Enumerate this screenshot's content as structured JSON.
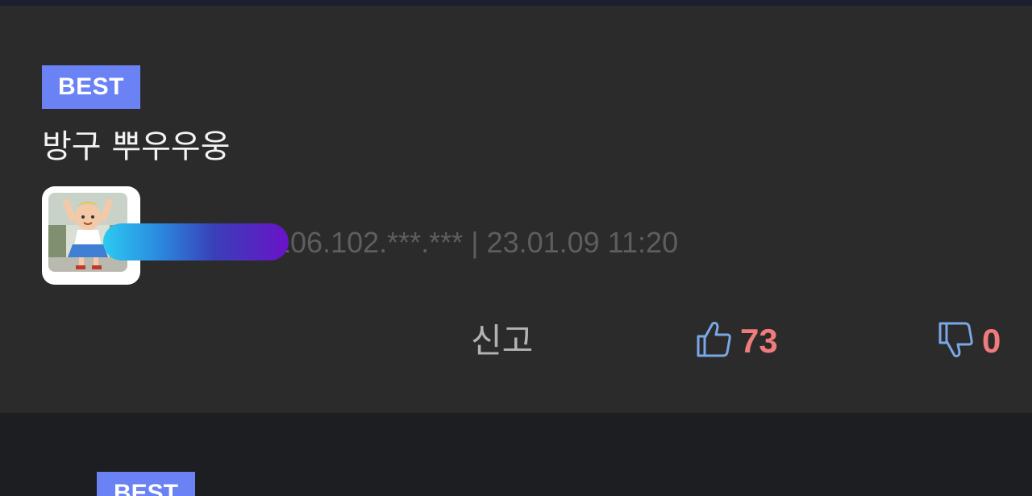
{
  "post": {
    "badge": "BEST",
    "title": "방구 뿌우우웅",
    "author_meta": "106.102.***.*** | 23.01.09 11:20"
  },
  "actions": {
    "report_label": "신고",
    "like_count": "73",
    "dislike_count": "0"
  },
  "next_post": {
    "badge": "BEST"
  },
  "icons": {
    "like": "thumbs-up-icon",
    "dislike": "thumbs-down-icon"
  },
  "colors": {
    "badge": "#6b82f5",
    "count": "#f07b7b",
    "icon": "#7aa7e6"
  }
}
